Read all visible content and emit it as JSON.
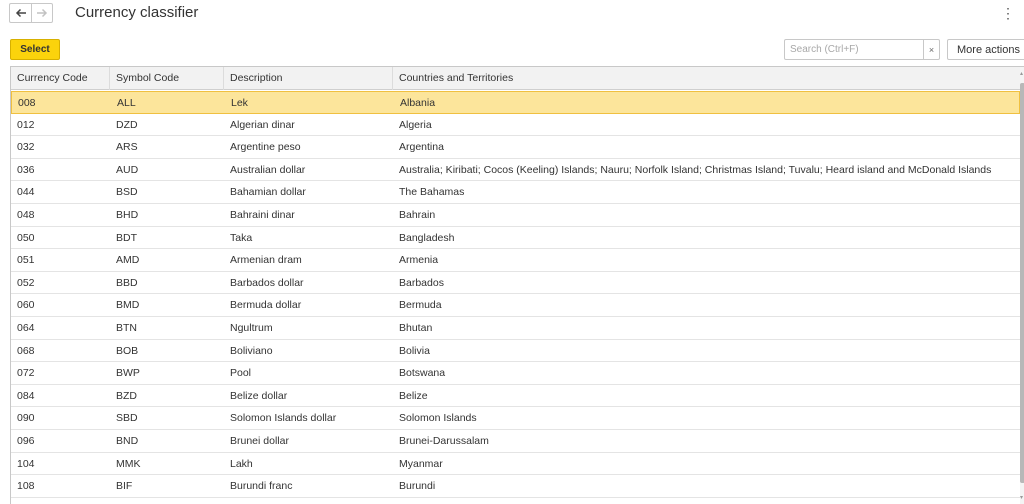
{
  "header": {
    "title": "Currency classifier",
    "back_icon": "arrow-left-icon",
    "forward_icon": "arrow-right-icon",
    "menu_icon": "kebab-menu-icon",
    "menu_glyph": "⋮"
  },
  "toolbar": {
    "select_label": "Select",
    "search_placeholder": "Search (Ctrl+F)",
    "search_value": "",
    "clear_glyph": "×",
    "more_actions_label": "More actions",
    "more_actions_caret": "▾"
  },
  "colors": {
    "accent": "#fbd30c",
    "selected_row": "#fce59b",
    "header_bg": "#f2f2f2"
  },
  "table": {
    "columns": [
      "Currency Code",
      "Symbol Code",
      "Description",
      "Countries and Territories"
    ],
    "selected_index": 0,
    "rows": [
      [
        "008",
        "ALL",
        "Lek",
        "Albania"
      ],
      [
        "012",
        "DZD",
        "Algerian dinar",
        "Algeria"
      ],
      [
        "032",
        "ARS",
        "Argentine peso",
        "Argentina"
      ],
      [
        "036",
        "AUD",
        "Australian dollar",
        "Australia; Kiribati; Cocos (Keeling) Islands; Nauru; Norfolk Island; Christmas Island; Tuvalu; Heard island and McDonald Islands"
      ],
      [
        "044",
        "BSD",
        "Bahamian dollar",
        "The Bahamas"
      ],
      [
        "048",
        "BHD",
        "Bahraini dinar",
        "Bahrain"
      ],
      [
        "050",
        "BDT",
        "Taka",
        "Bangladesh"
      ],
      [
        "051",
        "AMD",
        "Armenian dram",
        "Armenia"
      ],
      [
        "052",
        "BBD",
        "Barbados dollar",
        "Barbados"
      ],
      [
        "060",
        "BMD",
        "Bermuda dollar",
        "Bermuda"
      ],
      [
        "064",
        "BTN",
        "Ngultrum",
        "Bhutan"
      ],
      [
        "068",
        "BOB",
        "Boliviano",
        "Bolivia"
      ],
      [
        "072",
        "BWP",
        "Pool",
        "Botswana"
      ],
      [
        "084",
        "BZD",
        "Belize dollar",
        "Belize"
      ],
      [
        "090",
        "SBD",
        "Solomon Islands dollar",
        "Solomon Islands"
      ],
      [
        "096",
        "BND",
        "Brunei dollar",
        "Brunei-Darussalam"
      ],
      [
        "104",
        "MMK",
        "Lakh",
        "Myanmar"
      ],
      [
        "108",
        "BIF",
        "Burundi franc",
        "Burundi"
      ]
    ]
  }
}
